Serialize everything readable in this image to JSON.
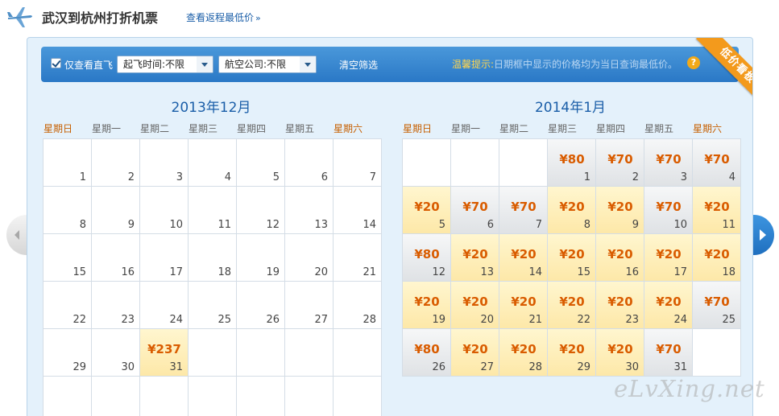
{
  "header": {
    "title": "武汉到杭州打折机票",
    "return_link": "查看返程最低价",
    "return_arrows": "»"
  },
  "filter": {
    "direct_only_label": "仅查看直飞",
    "direct_only_checked": true,
    "time_select": "起飞时间:不限",
    "airline_select": "航空公司:不限",
    "clear_label": "清空筛选",
    "tip_label": "温馨提示:",
    "tip_text": "日期框中显示的价格均为当日查询最低价。",
    "help_icon": "?"
  },
  "ribbon": "低价看板",
  "weekdays": [
    "星期日",
    "星期一",
    "星期二",
    "星期三",
    "星期四",
    "星期五",
    "星期六"
  ],
  "colors": {
    "price": "#d95c00",
    "weekend": "#c65f00",
    "title": "#1a5ea8",
    "bar": "#2a78c6"
  },
  "months": [
    {
      "title": "2013年12月",
      "first_weekday": 0,
      "days": 31,
      "rows": 6,
      "prices": {
        "31": {
          "price": "¥237",
          "style": "yellow"
        }
      }
    },
    {
      "title": "2014年1月",
      "first_weekday": 3,
      "days": 31,
      "rows": 5,
      "prices": {
        "1": {
          "price": "¥80",
          "style": "gray"
        },
        "2": {
          "price": "¥70",
          "style": "gray"
        },
        "3": {
          "price": "¥70",
          "style": "gray"
        },
        "4": {
          "price": "¥70",
          "style": "gray"
        },
        "5": {
          "price": "¥20",
          "style": "yellow"
        },
        "6": {
          "price": "¥70",
          "style": "gray"
        },
        "7": {
          "price": "¥70",
          "style": "gray"
        },
        "8": {
          "price": "¥20",
          "style": "yellow"
        },
        "9": {
          "price": "¥20",
          "style": "yellow"
        },
        "10": {
          "price": "¥70",
          "style": "gray"
        },
        "11": {
          "price": "¥20",
          "style": "yellow"
        },
        "12": {
          "price": "¥80",
          "style": "gray"
        },
        "13": {
          "price": "¥20",
          "style": "yellow"
        },
        "14": {
          "price": "¥20",
          "style": "yellow"
        },
        "15": {
          "price": "¥20",
          "style": "yellow"
        },
        "16": {
          "price": "¥20",
          "style": "yellow"
        },
        "17": {
          "price": "¥20",
          "style": "yellow"
        },
        "18": {
          "price": "¥20",
          "style": "yellow"
        },
        "19": {
          "price": "¥20",
          "style": "yellow"
        },
        "20": {
          "price": "¥20",
          "style": "yellow"
        },
        "21": {
          "price": "¥20",
          "style": "yellow"
        },
        "22": {
          "price": "¥20",
          "style": "yellow"
        },
        "23": {
          "price": "¥20",
          "style": "yellow"
        },
        "24": {
          "price": "¥20",
          "style": "yellow"
        },
        "25": {
          "price": "¥70",
          "style": "gray"
        },
        "26": {
          "price": "¥80",
          "style": "gray"
        },
        "27": {
          "price": "¥20",
          "style": "yellow"
        },
        "28": {
          "price": "¥20",
          "style": "yellow"
        },
        "29": {
          "price": "¥20",
          "style": "yellow"
        },
        "30": {
          "price": "¥20",
          "style": "yellow"
        },
        "31": {
          "price": "¥70",
          "style": "gray"
        }
      }
    }
  ],
  "watermark": "eLvXing.net"
}
